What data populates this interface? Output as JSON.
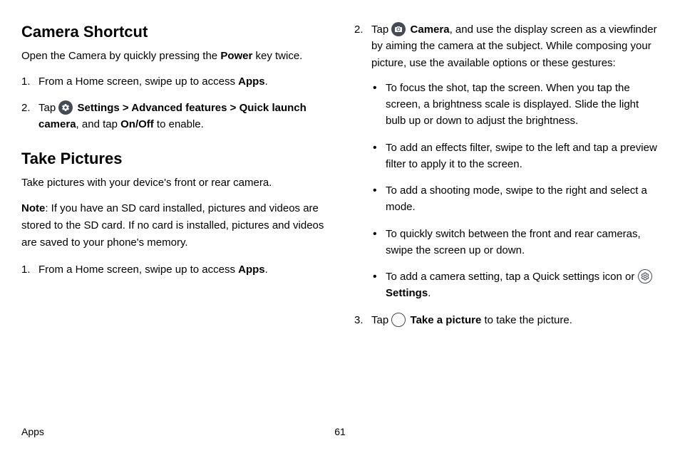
{
  "col1": {
    "h1": "Camera Shortcut",
    "intro_a": "Open the Camera by quickly pressing the ",
    "intro_b": "Power",
    "intro_c": " key twice.",
    "step1a": "From a Home screen, swipe up to access ",
    "step1b": "Apps",
    "step1c": ".",
    "step2a": "Tap ",
    "step2b": "Settings",
    "step2c": " > ",
    "step2d": "Advanced features",
    "step2e": " > ",
    "step2f": "Quick launch camera",
    "step2g": ", and tap ",
    "step2h": "On/Off",
    "step2i": " to enable.",
    "h2": "Take Pictures",
    "intro2": "Take pictures with your device's front or rear camera.",
    "note_a": "Note",
    "note_b": ": If you have an SD card installed, pictures and videos are stored to the SD card. If no card is installed, pictures and videos are saved to your phone's memory.",
    "tp_step1a": "From a Home screen, swipe up to access ",
    "tp_step1b": "Apps",
    "tp_step1c": "."
  },
  "col2": {
    "step2a": "Tap ",
    "step2b": "Camera",
    "step2c": ", and use the display screen as a viewfinder by aiming the camera at the subject. While composing your picture, use the available options or these gestures:",
    "b1": "To focus the shot, tap the screen. When you tap the screen, a brightness scale is displayed. Slide the light bulb up or down to adjust the brightness.",
    "b2": "To add an effects filter, swipe to the left and tap a preview filter to apply it to the screen.",
    "b3": "To add a shooting mode, swipe to the right and select a mode.",
    "b4": "To quickly switch between the front and rear cameras, swipe the screen up or down.",
    "b5a": "To add a camera setting, tap a Quick settings icon or ",
    "b5b": "Settings",
    "b5c": ".",
    "step3a": "Tap ",
    "step3b": "Take a picture",
    "step3c": " to take the picture."
  },
  "footer": {
    "section": "Apps",
    "page": "61"
  }
}
